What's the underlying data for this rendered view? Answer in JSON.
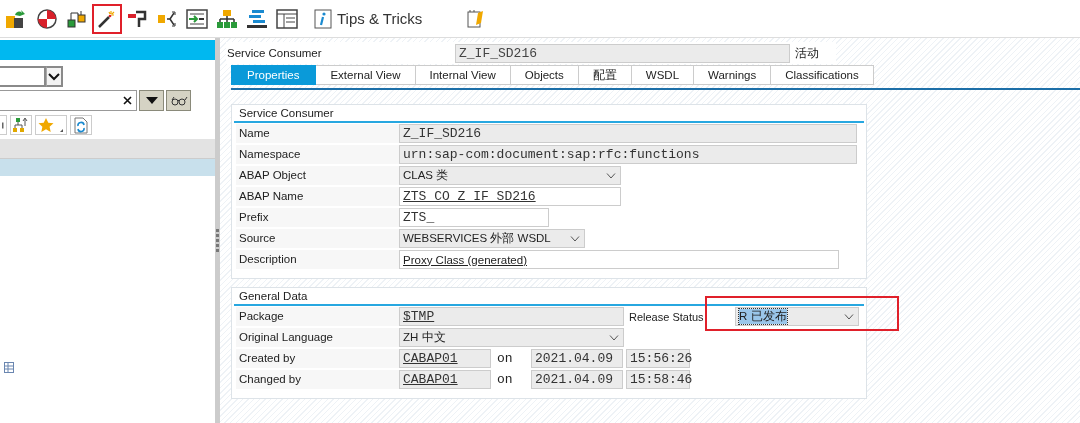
{
  "toolbar": {
    "buttons": [
      {
        "highlighted": false
      },
      {
        "highlighted": false
      },
      {
        "highlighted": false
      },
      {
        "highlighted": true
      },
      {
        "highlighted": false
      },
      {
        "highlighted": false
      },
      {
        "highlighted": false
      },
      {
        "highlighted": false
      },
      {
        "highlighted": false
      },
      {
        "highlighted": false
      }
    ],
    "tips": "Tips & Tricks"
  },
  "navigator": {
    "tree_rows": [
      {
        "selected": true
      }
    ]
  },
  "header": {
    "label": "Service Consumer",
    "value": "Z_IF_SD216",
    "status": "活动"
  },
  "tabs": [
    {
      "label": "Properties",
      "selected": true
    },
    {
      "label": "External View",
      "selected": false
    },
    {
      "label": "Internal View",
      "selected": false
    },
    {
      "label": "Objects",
      "selected": false
    },
    {
      "label": "配置",
      "selected": false
    },
    {
      "label": "WSDL",
      "selected": false
    },
    {
      "label": "Warnings",
      "selected": false
    },
    {
      "label": "Classifications",
      "selected": false
    }
  ],
  "groups": [
    {
      "title": "Service Consumer",
      "rows": [
        {
          "label": "Name",
          "fields": [
            {
              "kind": "display",
              "value": "Z_IF_SD216",
              "link": false
            }
          ]
        },
        {
          "label": "Namespace",
          "fields": [
            {
              "kind": "display",
              "value": "urn:sap-com:document:sap:rfc:functions",
              "link": false
            }
          ]
        },
        {
          "label": "ABAP Object",
          "fields": [
            {
              "kind": "dropdown",
              "value": "CLAS 类",
              "link": false
            }
          ]
        },
        {
          "label": "ABAP Name",
          "fields": [
            {
              "kind": "input",
              "value": "ZTS_CO_Z_IF_SD216",
              "link": true
            }
          ]
        },
        {
          "label": "Prefix",
          "fields": [
            {
              "kind": "input",
              "value": "ZTS_",
              "link": false
            }
          ]
        },
        {
          "label": "Source",
          "fields": [
            {
              "kind": "dropdown",
              "value": "WEBSERVICES 外部 WSDL",
              "link": false
            }
          ]
        },
        {
          "label": "Description",
          "fields": [
            {
              "kind": "textinput",
              "value": "Proxy Class (generated)",
              "link": true
            }
          ]
        }
      ]
    },
    {
      "title": "General Data",
      "rows": [
        {
          "label": "Package",
          "fields": [
            {
              "kind": "display",
              "value": "$TMP",
              "link": true
            },
            {
              "kind": "label",
              "value": "Release Status"
            },
            {
              "kind": "dropdown",
              "value": "R 已发布",
              "link": false,
              "text_selected": true,
              "highlighted": true
            }
          ]
        },
        {
          "label": "Original Language",
          "fields": [
            {
              "kind": "dropdown",
              "value": "ZH 中文",
              "link": false
            }
          ]
        },
        {
          "label": "Created by",
          "fields": [
            {
              "kind": "display",
              "value": "CABAP01",
              "link": true
            },
            {
              "kind": "word",
              "value": "on"
            },
            {
              "kind": "display",
              "value": "2021.04.09",
              "link": false
            },
            {
              "kind": "display",
              "value": "15:56:26",
              "link": false
            }
          ]
        },
        {
          "label": "Changed by",
          "fields": [
            {
              "kind": "display",
              "value": "CABAP01",
              "link": true
            },
            {
              "kind": "word",
              "value": "on"
            },
            {
              "kind": "display",
              "value": "2021.04.09",
              "link": false
            },
            {
              "kind": "display",
              "value": "15:58:46",
              "link": false
            }
          ]
        }
      ]
    }
  ]
}
